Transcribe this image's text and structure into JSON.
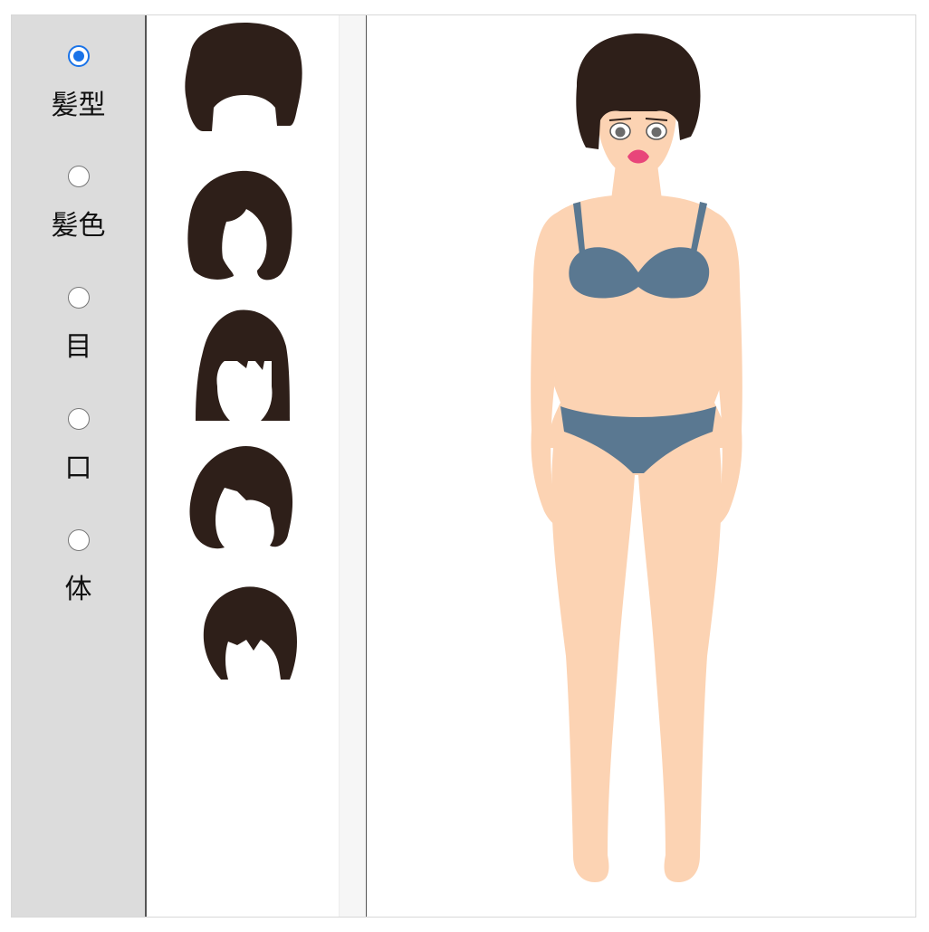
{
  "categories": [
    {
      "id": "hairstyle",
      "label": "髪型",
      "selected": true
    },
    {
      "id": "haircolor",
      "label": "髪色",
      "selected": false
    },
    {
      "id": "eyes",
      "label": "目",
      "selected": false
    },
    {
      "id": "mouth",
      "label": "口",
      "selected": false
    },
    {
      "id": "body",
      "label": "体",
      "selected": false
    }
  ],
  "hair_options": [
    "afro",
    "bob",
    "straight-bangs",
    "wavy",
    "short-shag"
  ],
  "colors": {
    "hair": "#2e1f19",
    "skin": "#fcd3b3",
    "underwear": "#5a7891",
    "lips": "#e8457a",
    "accent": "#1a73e8",
    "panel": "#dcdcdc"
  }
}
